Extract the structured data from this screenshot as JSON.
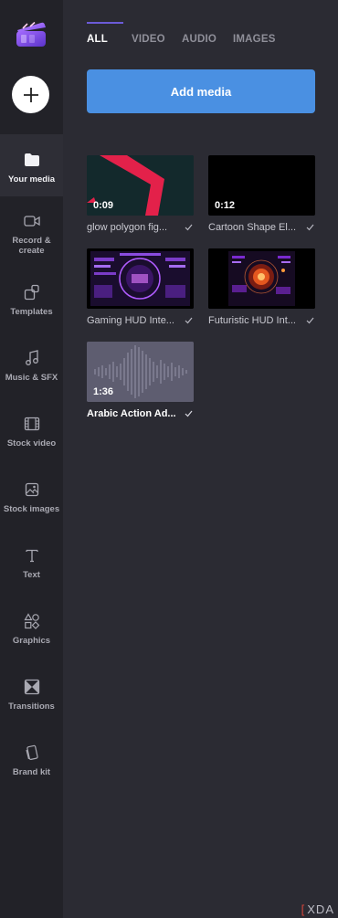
{
  "sidebar": {
    "logo_icon": "clipchamp-logo-icon",
    "add_icon": "plus-icon",
    "items": [
      {
        "label": "Your media",
        "icon": "folder-icon",
        "active": true
      },
      {
        "label": "Record &\ncreate",
        "icon": "camera-icon",
        "active": false
      },
      {
        "label": "Templates",
        "icon": "templates-icon",
        "active": false
      },
      {
        "label": "Music & SFX",
        "icon": "music-icon",
        "active": false
      },
      {
        "label": "Stock video",
        "icon": "film-icon",
        "active": false
      },
      {
        "label": "Stock images",
        "icon": "image-icon",
        "active": false
      },
      {
        "label": "Text",
        "icon": "text-icon",
        "active": false
      },
      {
        "label": "Graphics",
        "icon": "shapes-icon",
        "active": false
      },
      {
        "label": "Transitions",
        "icon": "transitions-icon",
        "active": false
      },
      {
        "label": "Brand kit",
        "icon": "brand-kit-icon",
        "active": false
      }
    ]
  },
  "tabs": [
    {
      "label": "ALL",
      "active": true
    },
    {
      "label": "VIDEO",
      "active": false
    },
    {
      "label": "AUDIO",
      "active": false
    },
    {
      "label": "IMAGES",
      "active": false
    }
  ],
  "add_media_label": "Add media",
  "media": [
    {
      "name": "glow polygon fig...",
      "duration": "0:09",
      "thumb": "red-polygon"
    },
    {
      "name": "Cartoon Shape El...",
      "duration": "0:12",
      "thumb": "black"
    },
    {
      "name": "Gaming HUD Inte...",
      "duration": "",
      "thumb": "hud-purple"
    },
    {
      "name": "Futuristic HUD Int...",
      "duration": "",
      "thumb": "hud-orange"
    },
    {
      "name": "Arabic Action Ad...",
      "duration": "1:36",
      "thumb": "waveform"
    }
  ],
  "watermark": {
    "bracket": "[",
    "text": "XDA"
  },
  "colors": {
    "sidebar_bg": "#222228",
    "main_bg": "#2b2b33",
    "accent": "#4a90e2",
    "tab_indicator": "#6b5bd8"
  }
}
